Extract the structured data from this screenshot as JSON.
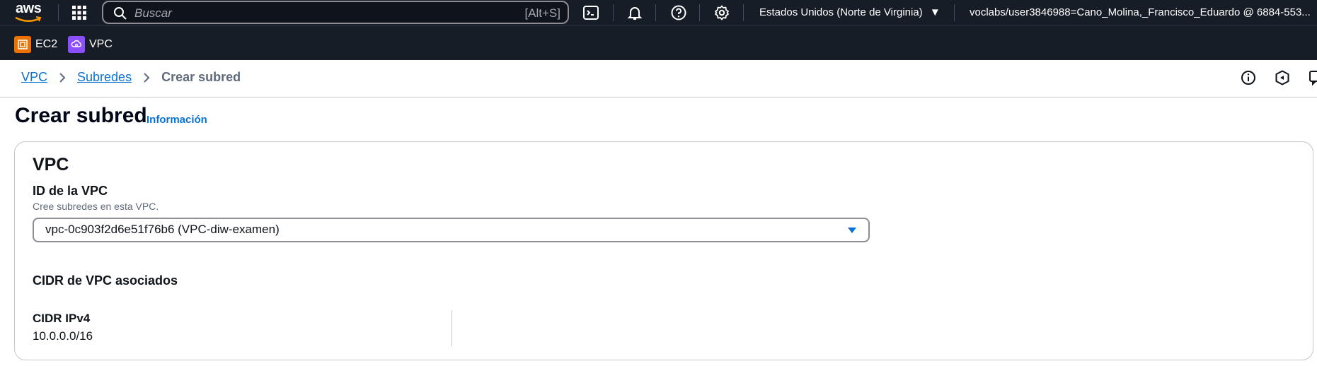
{
  "topnav": {
    "logo": "aws",
    "search_placeholder": "Buscar",
    "search_shortcut": "[Alt+S]",
    "region": "Estados Unidos (Norte de Virginia)",
    "account": "voclabs/user3846988=Cano_Molina,_Francisco_Eduardo @ 6884-553..."
  },
  "services": [
    {
      "label": "EC2",
      "color": "#ed7100"
    },
    {
      "label": "VPC",
      "color": "#8c4fff"
    }
  ],
  "breadcrumb": {
    "items": [
      "VPC",
      "Subredes"
    ],
    "current": "Crear subred"
  },
  "page": {
    "title": "Crear subred",
    "info_link": "Información"
  },
  "vpc_section": {
    "title": "VPC",
    "vpc_id_label": "ID de la VPC",
    "vpc_id_description": "Cree subredes en esta VPC.",
    "vpc_id_value": "vpc-0c903f2d6e51f76b6 (VPC-diw-examen)",
    "associated_cidr_heading": "CIDR de VPC asociados",
    "ipv4_cidr_label": "CIDR IPv4",
    "ipv4_cidr_value": "10.0.0.0/16"
  },
  "colors": {
    "nav_bg": "#161d26",
    "link": "#0972d3",
    "caret": "#0972d3"
  }
}
